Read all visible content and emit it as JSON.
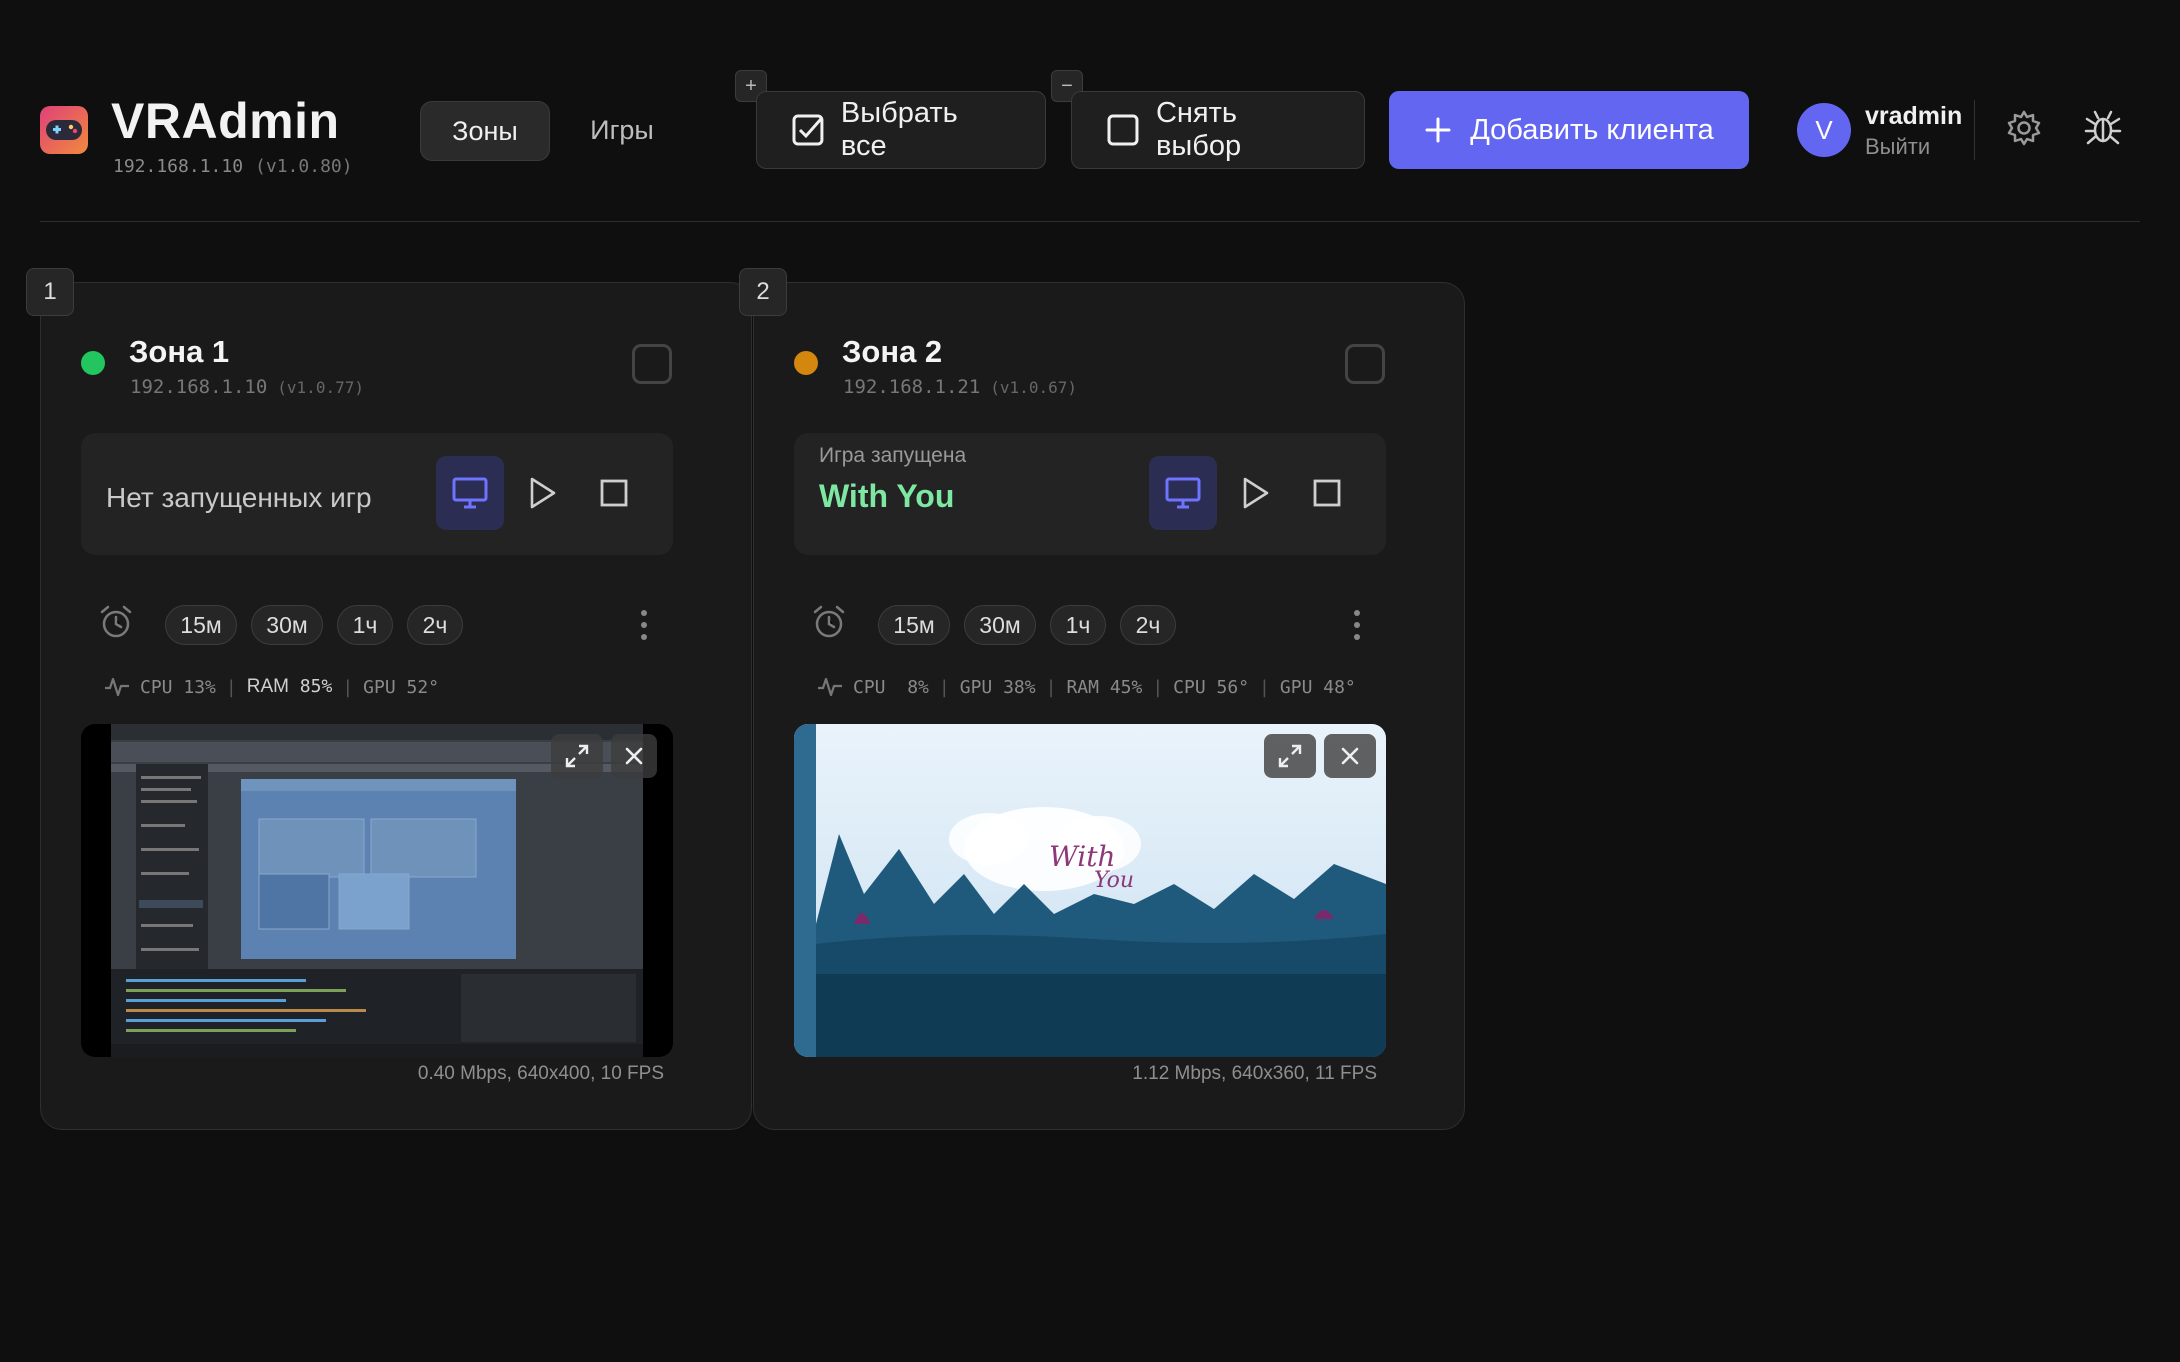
{
  "header": {
    "app_title": "VRAdmin",
    "server_ip": "192.168.1.10",
    "server_version": "(v1.0.80)",
    "nav_tabs": [
      {
        "label": "Зоны",
        "active": true
      },
      {
        "label": "Игры",
        "active": false
      }
    ],
    "expand_badge": "+",
    "collapse_badge": "−",
    "select_all_label": "Выбрать все",
    "deselect_label": "Снять выбор",
    "add_client_label": "Добавить клиента",
    "user": {
      "initial": "V",
      "name": "vradmin",
      "logout_label": "Выйти"
    },
    "accent_color": "#6366f1"
  },
  "zones": [
    {
      "number": "1",
      "title": "Зона 1",
      "ip": "192.168.1.10",
      "version": "(v1.0.77)",
      "status_color": "#22c55e",
      "game_status": "Нет запущенных игр",
      "timers": [
        "15м",
        "30м",
        "1ч",
        "2ч"
      ],
      "stats": {
        "cpu_label": "CPU",
        "cpu_value": "13%",
        "ram_label": "RAM",
        "ram_value": "85%",
        "gpu_temp_label": "GPU",
        "gpu_temp_value": "52°"
      },
      "stream_info": "0.40 Mbps, 640x400, 10 FPS"
    },
    {
      "number": "2",
      "title": "Зона 2",
      "ip": "192.168.1.21",
      "version": "(v1.0.67)",
      "status_color": "#d4870f",
      "game_label": "Игра запущена",
      "game_name": "With You",
      "timers": [
        "15м",
        "30м",
        "1ч",
        "2ч"
      ],
      "stats": {
        "cpu_label": "CPU",
        "cpu_value": "8%",
        "gpu_label": "GPU",
        "gpu_value": "38%",
        "ram_label": "RAM",
        "ram_value": "45%",
        "cpu_temp_label": "CPU",
        "cpu_temp_value": "56°",
        "gpu_temp_label": "GPU",
        "gpu_temp_value": "48°"
      },
      "preview_text_line1": "With",
      "preview_text_line2": "You",
      "stream_info": "1.12 Mbps, 640x360, 11 FPS"
    }
  ]
}
